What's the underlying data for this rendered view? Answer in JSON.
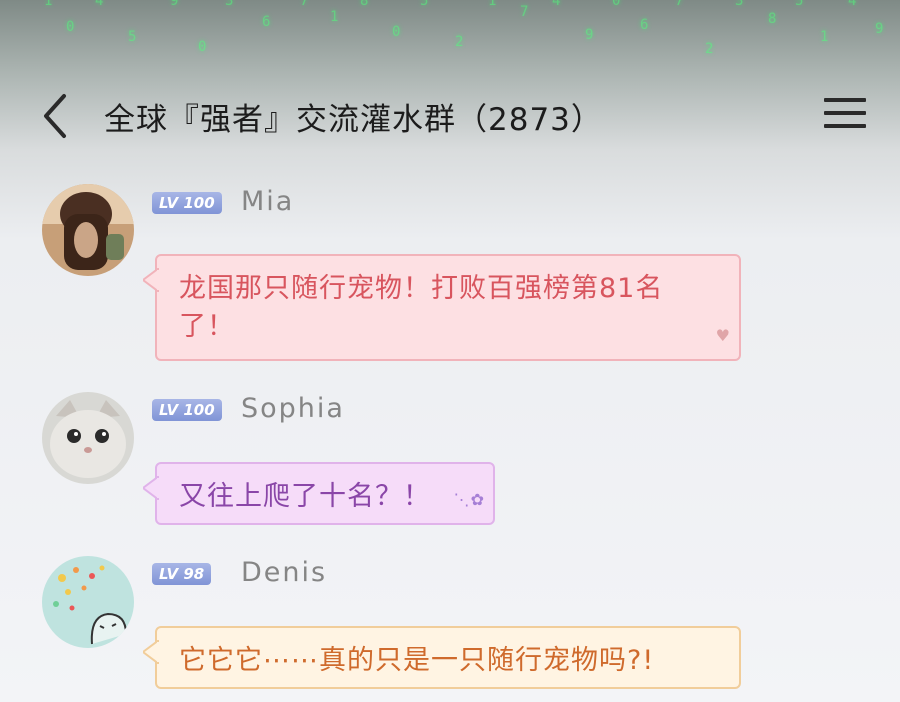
{
  "header": {
    "back_icon": "chevron-left-icon",
    "title": "全球『强者』交流灌水群（2873）",
    "menu_icon": "hamburger-menu-icon"
  },
  "background": {
    "matrix_columns": [
      "1",
      "0",
      "4",
      "5",
      "9",
      "0",
      "3",
      "6",
      "7",
      "1",
      "8",
      "0",
      "5",
      "2",
      "1",
      "7",
      "4",
      "9",
      "0",
      "6",
      "7",
      "2",
      "3",
      "8",
      "5",
      "1",
      "4",
      "9"
    ]
  },
  "messages": [
    {
      "sender": "Mia",
      "level": "LV 100",
      "text": "龙国那只随行宠物！打败百强榜第81名了！",
      "bubble_style": "pink",
      "decoration": "heart-icon"
    },
    {
      "sender": "Sophia",
      "level": "LV 100",
      "text": "又往上爬了十名？！",
      "bubble_style": "purple",
      "decoration": "butterfly-icon"
    },
    {
      "sender": "Denis",
      "level": "LV 98",
      "text": "它它它⋯⋯真的只是一只随行宠物吗?!",
      "bubble_style": "orange",
      "decoration": ""
    }
  ],
  "colors": {
    "pink_text": "#d8555e",
    "purple_text": "#8a46a8",
    "orange_text": "#cf6a2c",
    "level_badge": "#8094d6",
    "matrix_green": "#4dff7a"
  }
}
